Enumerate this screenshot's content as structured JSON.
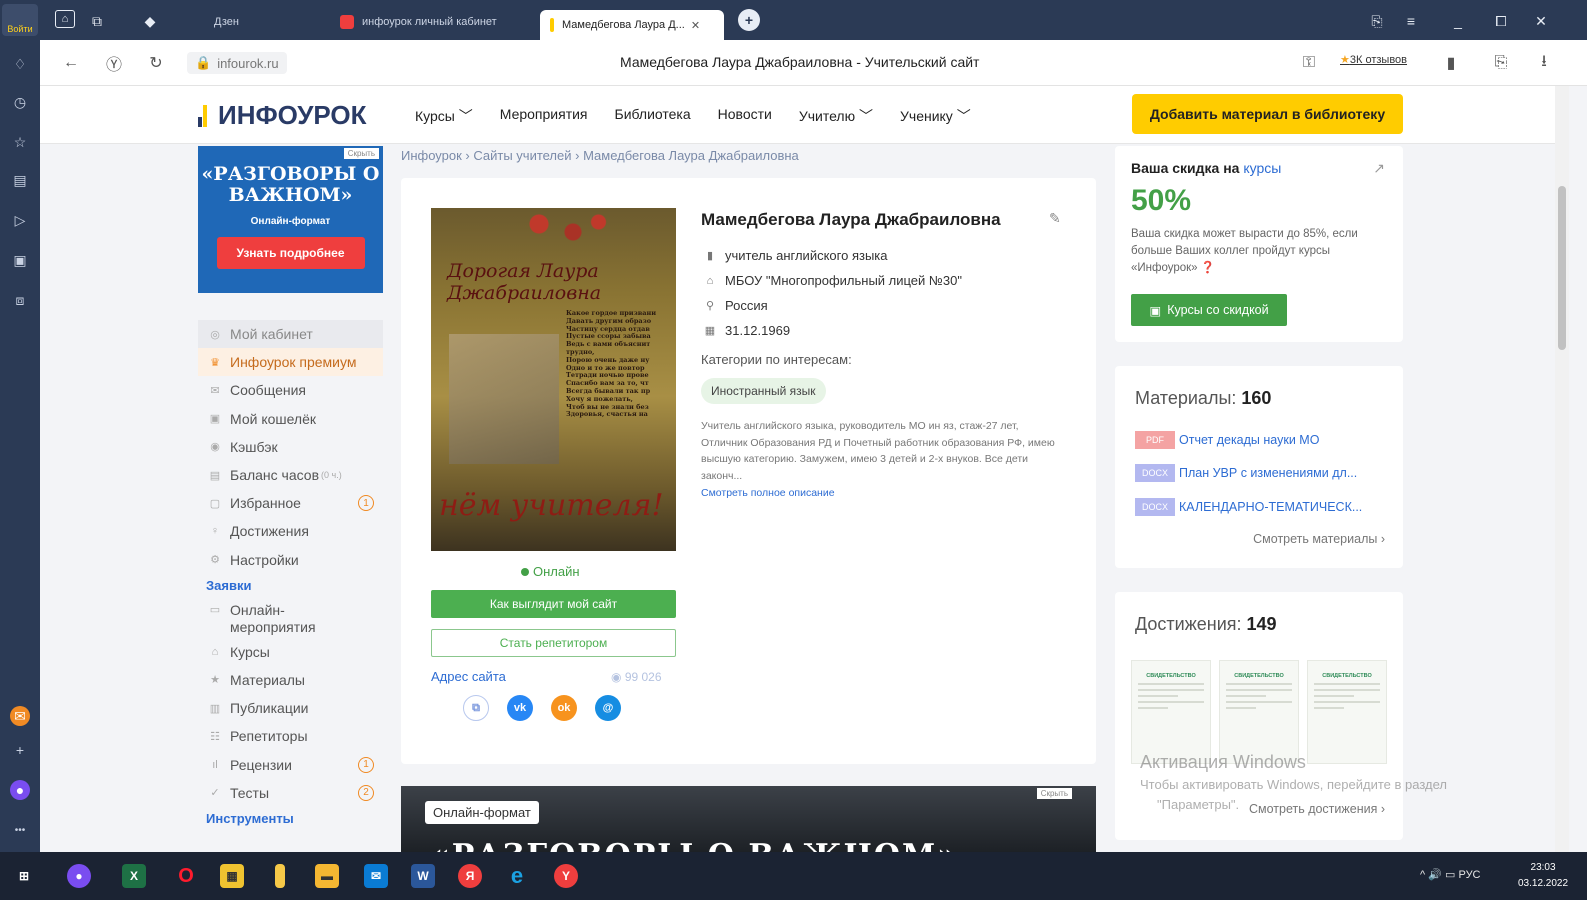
{
  "browser": {
    "signin_label": "Войти",
    "tabs": [
      {
        "label": "Дзен",
        "active": false
      },
      {
        "label": "инфоурок личный кабинет",
        "active": false
      },
      {
        "label": "Мамедбегова Лаура Д...",
        "active": true
      }
    ],
    "url": "infourok.ru",
    "page_title": "Мамедбегова Лаура Джабраиловна - Учительский сайт",
    "reviews": "3К отзывов"
  },
  "header": {
    "logo": "ИНФОУРОК",
    "nav": [
      "Курсы",
      "Мероприятия",
      "Библиотека",
      "Новости",
      "Учителю",
      "Ученику"
    ],
    "add_button": "Добавить материал в библиотеку"
  },
  "promo": {
    "hide": "Скрыть",
    "title": "«РАЗГОВОРЫ О ВАЖНОМ»",
    "subtitle": "Онлайн-формат",
    "button": "Узнать подробнее"
  },
  "menu": {
    "items": [
      {
        "label": "Мой кабинет",
        "icon": "home-icon"
      },
      {
        "label": "Инфоурок премиум",
        "icon": "crown-icon"
      },
      {
        "label": "Сообщения",
        "icon": "mail-icon"
      },
      {
        "label": "Мой кошелёк",
        "icon": "wallet-icon"
      },
      {
        "label": "Кэшбэк",
        "icon": "cashback-icon"
      },
      {
        "label": "Баланс часов",
        "icon": "clock-icon",
        "extra": "(0 ч.)"
      },
      {
        "label": "Избранное",
        "icon": "bookmark-icon",
        "badge": "1"
      },
      {
        "label": "Достижения",
        "icon": "trophy-icon"
      },
      {
        "label": "Настройки",
        "icon": "gear-icon"
      }
    ],
    "section_requests": "Заявки",
    "requests": [
      {
        "label": "Онлайн-мероприятия",
        "icon": "video-icon"
      },
      {
        "label": "Курсы",
        "icon": "graduation-icon"
      },
      {
        "label": "Материалы",
        "icon": "star-icon"
      },
      {
        "label": "Публикации",
        "icon": "newspaper-icon"
      },
      {
        "label": "Репетиторы",
        "icon": "users-icon"
      },
      {
        "label": "Рецензии",
        "icon": "chart-icon",
        "badge": "1"
      },
      {
        "label": "Тесты",
        "icon": "check-icon",
        "badge": "2"
      }
    ],
    "section_tools": "Инструменты"
  },
  "breadcrumb": "Инфоурок › Сайты учителей › Мамедбегова Лаура Джабраиловна",
  "profile": {
    "photo_text": "Дорогая Лаура Джабраиловна",
    "photo_bottom": "нём учителя!",
    "photo_poem": [
      "Какое гордое призвани",
      "Давать другим образо",
      "Частицу сердца отдав",
      "Пустые ссоры забыва",
      "Ведь с вами объяснит",
      "трудно,",
      "Порою очень даже ну",
      "Одно и то же повтор",
      "Тетради ночью прове",
      "Спасибо вам за то, чт",
      "Всегда бывали так пр",
      "Хочу я пожелать,",
      "Чтоб вы не знали без",
      "Здоровья, счастья на"
    ],
    "status": "Онлайн",
    "btn_site": "Как выглядит мой сайт",
    "btn_tutor": "Стать репетитором",
    "address_label": "Адрес сайта",
    "views": "99 026",
    "name": "Мамедбегова Лаура Джабраиловна",
    "position": "учитель английского языка",
    "school": "МБОУ \"Многопрофильный лицей №30\"",
    "country": "Россия",
    "birthdate": "31.12.1969",
    "categories_label": "Категории по интересам:",
    "tag": "Иностранный язык",
    "bio": "Учитель английского языка, руководитель МО ин яз, стаж-27 лет, Отличник Образования РД и Почетный работник образования РФ, имею высшую категорию. Замужем, имею 3 детей и 2-х внуков. Все дети законч...",
    "more": "Смотреть полное описание"
  },
  "banner2": {
    "pill": "Онлайн-формат",
    "hide": "Скрыть",
    "title": "«РАЗГОВОРЫ О ВАЖНОМ»"
  },
  "discount": {
    "title_prefix": "Ваша скидка на",
    "title_link": "курсы",
    "percent": "50%",
    "text": "Ваша скидка может вырасти до 85%, если больше Ваших коллег пройдут курсы «Инфоурок»",
    "button": "Курсы со скидкой"
  },
  "materials": {
    "title": "Материалы:",
    "count": "160",
    "items": [
      {
        "type": "PDF",
        "color": "#f4a3a3",
        "title": "Отчет декады науки МО"
      },
      {
        "type": "DOCX",
        "color": "#b3b8f0",
        "title": "План УВР с изменениями дл..."
      },
      {
        "type": "DOCX",
        "color": "#b3b8f0",
        "title": "КАЛЕНДАРНО-ТЕМАТИЧЕСК..."
      }
    ],
    "more": "Смотреть материалы ›"
  },
  "achievements": {
    "title": "Достижения:",
    "count": "149",
    "cert_label": "СВИДЕТЕЛЬСТВО",
    "more": "Смотреть достижения ›"
  },
  "windows": {
    "watermark_title": "Активация Windows",
    "watermark_text": "Чтобы активировать Windows, перейдите в раздел",
    "watermark_text2": "\"Параметры\".",
    "tray_lang": "РУС",
    "time": "23:03",
    "date": "03.12.2022"
  }
}
